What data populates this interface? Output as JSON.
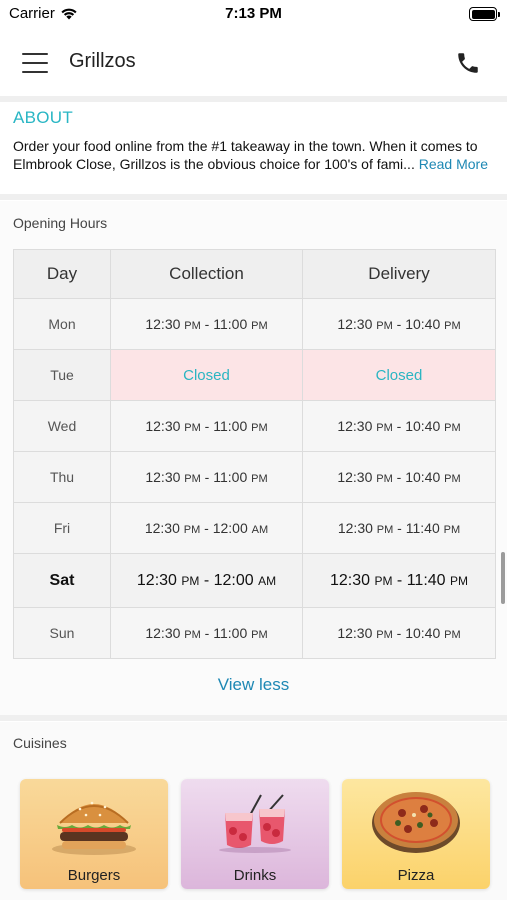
{
  "status_bar": {
    "carrier": "Carrier",
    "time": "7:13 PM"
  },
  "header": {
    "title": "Grillzos"
  },
  "about": {
    "title": "ABOUT",
    "line1": "Order your food online from the #1 takeaway in the town. When it comes to",
    "line2": "Elmbrook Close, Grillzos is the obvious choice for 100's of fami...",
    "read_more": "Read More"
  },
  "opening_hours": {
    "title": "Opening Hours",
    "columns": [
      "Day",
      "Collection",
      "Delivery"
    ],
    "rows": [
      {
        "day": "Mon",
        "collection": [
          "12:30",
          "PM",
          "11:00",
          "PM"
        ],
        "delivery": [
          "12:30",
          "PM",
          "10:40",
          "PM"
        ]
      },
      {
        "day": "Tue",
        "collection_closed": "Closed",
        "delivery_closed": "Closed"
      },
      {
        "day": "Wed",
        "collection": [
          "12:30",
          "PM",
          "11:00",
          "PM"
        ],
        "delivery": [
          "12:30",
          "PM",
          "10:40",
          "PM"
        ]
      },
      {
        "day": "Thu",
        "collection": [
          "12:30",
          "PM",
          "11:00",
          "PM"
        ],
        "delivery": [
          "12:30",
          "PM",
          "10:40",
          "PM"
        ]
      },
      {
        "day": "Fri",
        "collection": [
          "12:30",
          "PM",
          "12:00",
          "AM"
        ],
        "delivery": [
          "12:30",
          "PM",
          "11:40",
          "PM"
        ]
      },
      {
        "day": "Sat",
        "collection": [
          "12:30",
          "PM",
          "12:00",
          "AM"
        ],
        "delivery": [
          "12:30",
          "PM",
          "11:40",
          "PM"
        ]
      },
      {
        "day": "Sun",
        "collection": [
          "12:30",
          "PM",
          "11:00",
          "PM"
        ],
        "delivery": [
          "12:30",
          "PM",
          "10:40",
          "PM"
        ]
      }
    ],
    "separator": " - ",
    "view_less": "View less"
  },
  "cuisines": {
    "title": "Cuisines",
    "items": [
      {
        "label": "Burgers"
      },
      {
        "label": "Drinks"
      },
      {
        "label": "Pizza"
      }
    ]
  },
  "colors": {
    "accent_teal": "#29b6c4",
    "link_blue": "#1e88b4",
    "closed_bg": "#fce4e6"
  },
  "icons": {
    "menu": "hamburger-menu-icon",
    "phone": "phone-icon",
    "wifi": "wifi-icon",
    "battery": "battery-icon"
  }
}
